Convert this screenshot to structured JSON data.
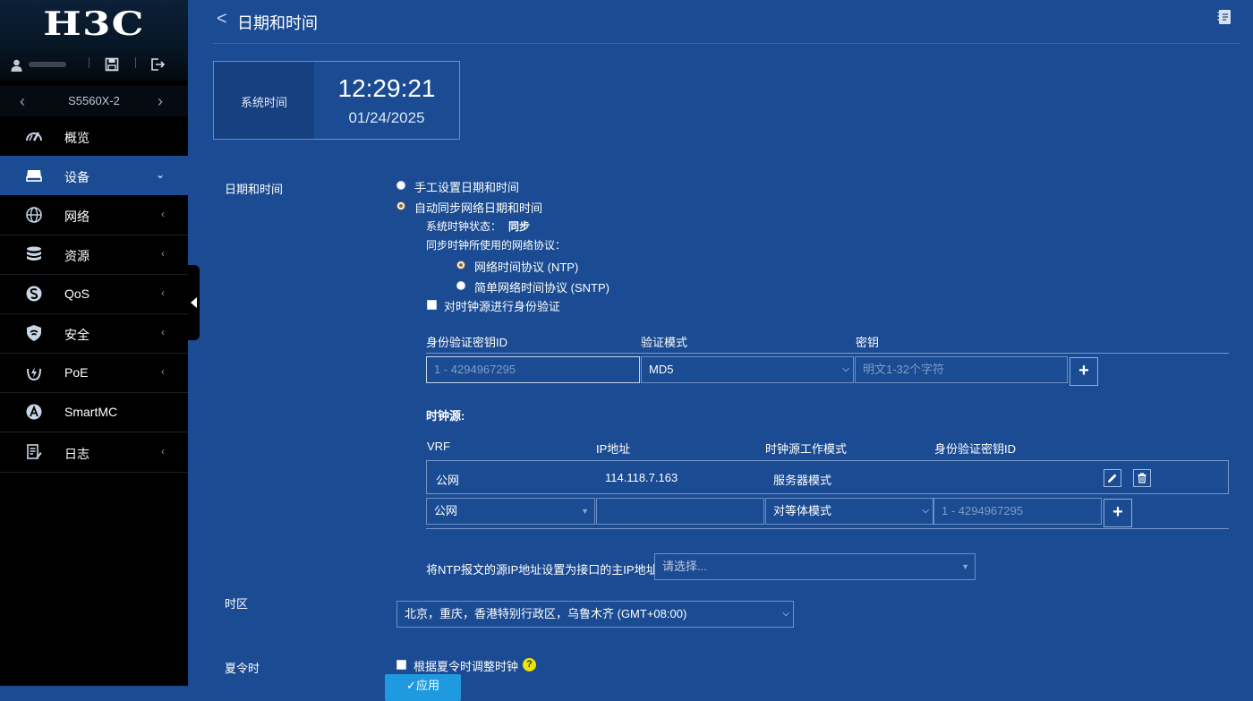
{
  "sidebar": {
    "brand": "H3C",
    "device_name": "S5560X-2",
    "items": [
      {
        "label": "概览",
        "icon": "dashboard-icon",
        "active": false
      },
      {
        "label": "设备",
        "icon": "device-icon",
        "active": true
      },
      {
        "label": "网络",
        "icon": "globe-icon",
        "active": false
      },
      {
        "label": "资源",
        "icon": "database-icon",
        "active": false
      },
      {
        "label": "QoS",
        "icon": "qos-icon",
        "active": false
      },
      {
        "label": "安全",
        "icon": "shield-icon",
        "active": false
      },
      {
        "label": "PoE",
        "icon": "poe-icon",
        "active": false
      },
      {
        "label": "SmartMC",
        "icon": "smartmc-icon",
        "active": false
      },
      {
        "label": "日志",
        "icon": "log-icon",
        "active": false
      }
    ],
    "arrows": {
      "collapsed": "‹",
      "expanded": "⌄",
      "prev": "‹",
      "next": "›"
    }
  },
  "header": {
    "back": "<",
    "title": "日期和时间"
  },
  "clock": {
    "label": "系统时间",
    "time": "12:29:21",
    "date": "01/24/2025"
  },
  "datetime": {
    "section_label": "日期和时间",
    "manual_label": "手工设置日期和时间",
    "auto_label": "自动同步网络日期和时间",
    "status_label": "系统时钟状态：",
    "status_value": "同步",
    "protocol_label": "同步时钟所使用的网络协议：",
    "ntp_label": "网络时间协议 (NTP)",
    "sntp_label": "简单网络时间协议 (SNTP)",
    "auth_label": "对时钟源进行身份验证"
  },
  "auth_table": {
    "headers": [
      "身份验证密钥ID",
      "验证模式",
      "密钥"
    ],
    "key_id_placeholder": "1 - 4294967295",
    "mode_value": "MD5",
    "key_placeholder": "明文1-32个字符",
    "add_label": "+"
  },
  "sources": {
    "label": "时钟源:",
    "headers": [
      "VRF",
      "IP地址",
      "时钟源工作模式",
      "身份验证密钥ID"
    ],
    "rows": [
      {
        "vrf": "公网",
        "ip": "114.118.7.163",
        "mode": "服务器模式",
        "key_id": ""
      }
    ],
    "new_row": {
      "vrf_value": "公网",
      "mode_value": "对等体模式",
      "key_id_placeholder": "1 - 4294967295",
      "add_label": "+"
    }
  },
  "source_ip": {
    "label": "将NTP报文的源IP地址设置为接口的主IP地址",
    "placeholder": "请选择..."
  },
  "timezone": {
    "label": "时区",
    "value": "北京，重庆，香港特别行政区，乌鲁木齐 (GMT+08:00)"
  },
  "dst": {
    "label": "夏令时",
    "checkbox_label": "根据夏令时调整时钟",
    "help": "?"
  },
  "apply": {
    "label": "✓应用"
  },
  "colors": {
    "sidebar_bg": "#000000",
    "main_bg": "#1b4b92",
    "accent": "#1f9ae0"
  }
}
